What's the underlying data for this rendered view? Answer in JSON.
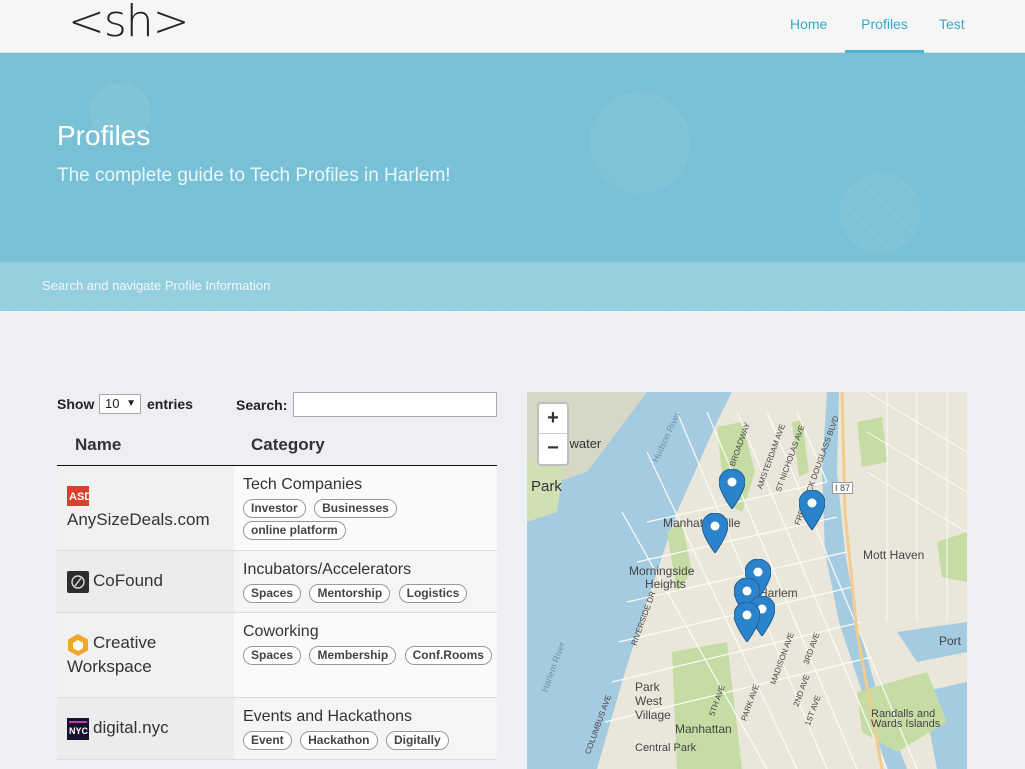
{
  "navbar": {
    "logo": "<sh>",
    "items": [
      {
        "label": "Home",
        "active": false
      },
      {
        "label": "Profiles",
        "active": true
      },
      {
        "label": "Test",
        "active": false
      }
    ],
    "active_color": "#4fb3d2"
  },
  "hero": {
    "title": "Profiles",
    "subtitle": "The complete guide to Tech Profiles in Harlem!",
    "bar_text": "Search and navigate Profile Information",
    "bg_color": "#78c0d6"
  },
  "table_controls": {
    "show_label": "Show",
    "entries_value": "10",
    "entries_label": "entries",
    "search_label": "Search:",
    "search_value": ""
  },
  "table": {
    "columns": [
      "Name",
      "Category"
    ],
    "rows": [
      {
        "name": "AnySizeDeals.com",
        "icon": "anysizedeals-logo-icon",
        "category": "Tech Companies",
        "tags": [
          "Investor",
          "Businesses",
          "online platform"
        ]
      },
      {
        "name": "CoFound",
        "icon": "cofound-logo-icon",
        "category": "Incubators/Accelerators",
        "tags": [
          "Spaces",
          "Mentorship",
          "Logistics"
        ]
      },
      {
        "name": "Creative Workspace",
        "icon": "creative-workspace-logo-icon",
        "category": "Coworking",
        "tags": [
          "Spaces",
          "Membership",
          "Conf.Rooms"
        ]
      },
      {
        "name": "digital.nyc",
        "icon": "digital-nyc-logo-icon",
        "category": "Events and Hackathons",
        "tags": [
          "Event",
          "Hackathon",
          "Digitally"
        ]
      }
    ]
  },
  "map": {
    "zoom_in": "+",
    "zoom_out": "−",
    "labels": {
      "edgewater": "gewater",
      "park": "Park",
      "manhattanville": "Manhattanville",
      "morningside": "Morningside",
      "heights": "Heights",
      "harlem": "Harlem",
      "mott_haven": "Mott Haven",
      "port": "Port",
      "park_west_1": "Park",
      "park_west_2": "West",
      "park_west_3": "Village",
      "manhattan": "Manhattan",
      "central_park": "Central Park",
      "randalls_1": "Randalls and",
      "randalls_2": "Wards Islands",
      "hudson": "Hudson River",
      "harlem_river": "Harlem River",
      "i87": "I 87",
      "broadway": "BROADWAY",
      "amsterdam": "AMSTERDAM AVE",
      "st_nicholas": "ST NICHOLAS AVE",
      "fdb": "FREDERICK DOUGLASS BLVD",
      "riverside": "RIVERSIDE DR",
      "madison": "MADISON AVE",
      "third": "3RD AVE",
      "second": "2ND AVE",
      "first": "1ST AVE",
      "park_ave": "PARK AVE",
      "fifth": "5TH AVE",
      "columbus": "COLUMBUS AVE"
    },
    "colors": {
      "water": "#a5cbe0",
      "land": "#ebe6da",
      "park": "#c5dca4",
      "road": "#fbfbf6",
      "marker": "#2b83cb"
    }
  }
}
